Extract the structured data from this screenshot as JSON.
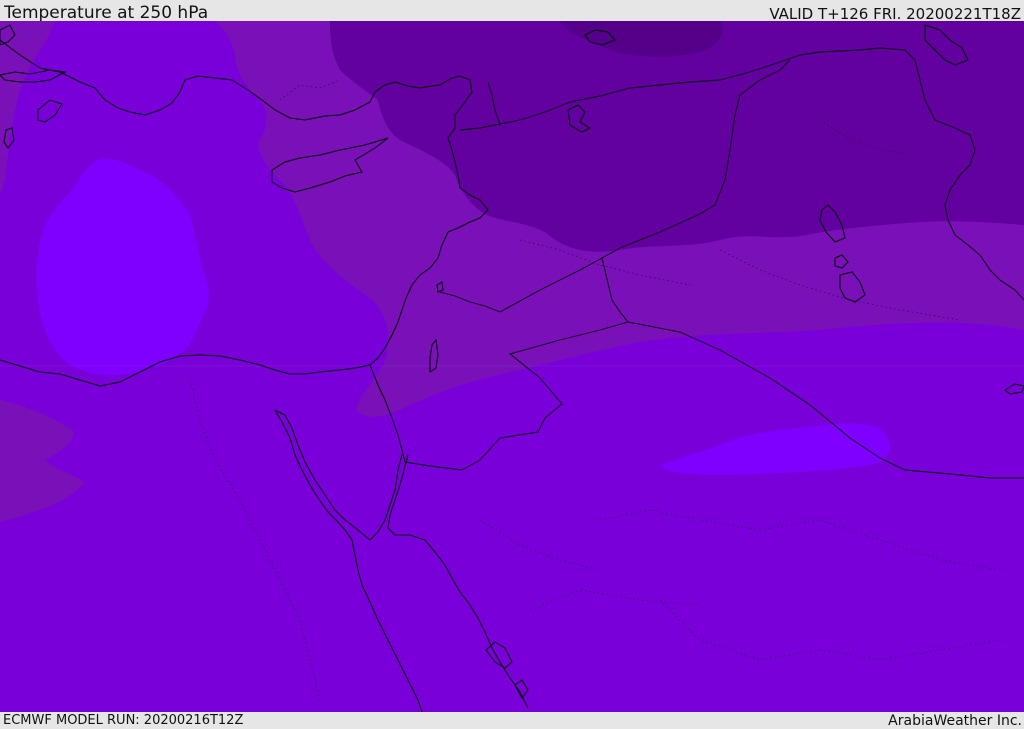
{
  "header": {
    "title": "Temperature at 250 hPa",
    "valid": "VALID T+126 FRI. 20200221T18Z"
  },
  "footer": {
    "model_run": "ECMWF MODEL RUN: 20200216T12Z",
    "brand": "ArabiaWeather Inc."
  },
  "map": {
    "variable": "temperature",
    "level_hpa": 250,
    "colors": {
      "base": "#7a00d9",
      "warm_pool": "#7f00ff",
      "mid_band": "#7a10b8",
      "cold_band": "#6200a0",
      "coldest_core": "#55008a",
      "coastline": "#000000",
      "border": "#000000"
    }
  }
}
